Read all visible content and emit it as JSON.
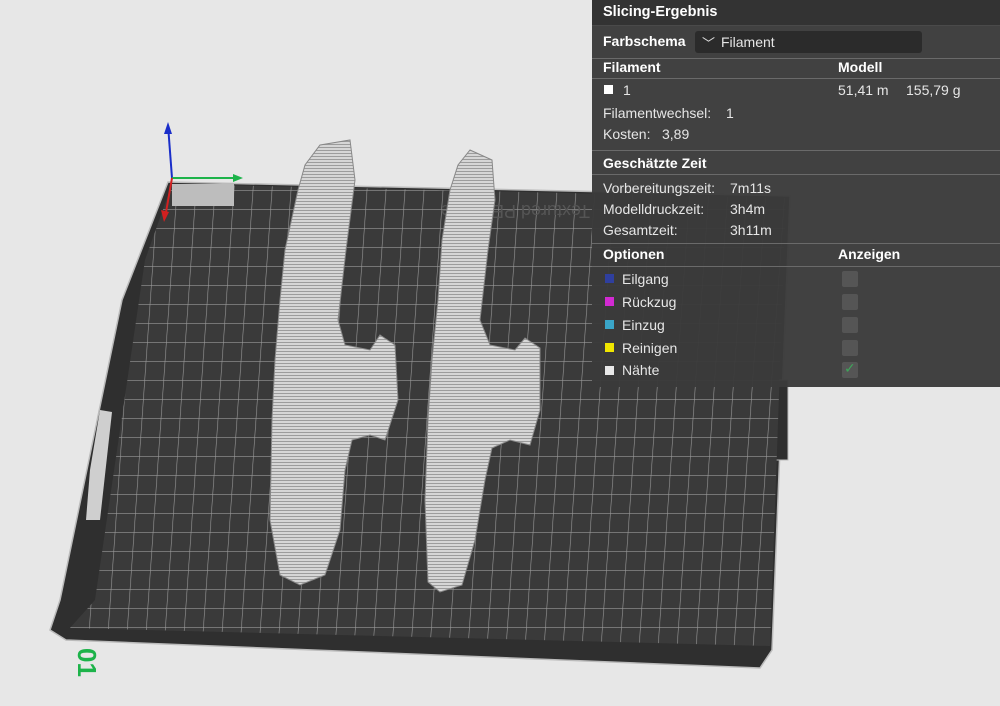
{
  "viewport": {
    "bed_id_label": "01",
    "bed_text": "Textured PEI Plate"
  },
  "panel": {
    "title": "Slicing-Ergebnis",
    "color_scheme_label": "Farbschema",
    "color_scheme_value": "Filament",
    "filament_header": "Filament",
    "model_header": "Modell",
    "filament_row": {
      "id": "1",
      "length": "51,41 m",
      "weight": "155,79 g",
      "swatch_color": "#ffffff"
    },
    "filament_changes_label": "Filamentwechsel:",
    "filament_changes_value": "1",
    "cost_label": "Kosten:",
    "cost_value": "3,89",
    "estimated_time_header": "Geschätzte Zeit",
    "prep_time_label": "Vorbereitungszeit:",
    "prep_time_value": "7m11s",
    "model_time_label": "Modelldruckzeit:",
    "model_time_value": "3h4m",
    "total_time_label": "Gesamtzeit:",
    "total_time_value": "3h11m",
    "options_header": "Optionen",
    "show_header": "Anzeigen",
    "options": [
      {
        "label": "Eilgang",
        "color": "#2f3f9e",
        "checked": false
      },
      {
        "label": "Rückzug",
        "color": "#d22ad2",
        "checked": false
      },
      {
        "label": "Einzug",
        "color": "#3aa5c8",
        "checked": false
      },
      {
        "label": "Reinigen",
        "color": "#f0e600",
        "checked": false
      },
      {
        "label": "Nähte",
        "color": "#e8e8e8",
        "checked": true
      }
    ]
  }
}
